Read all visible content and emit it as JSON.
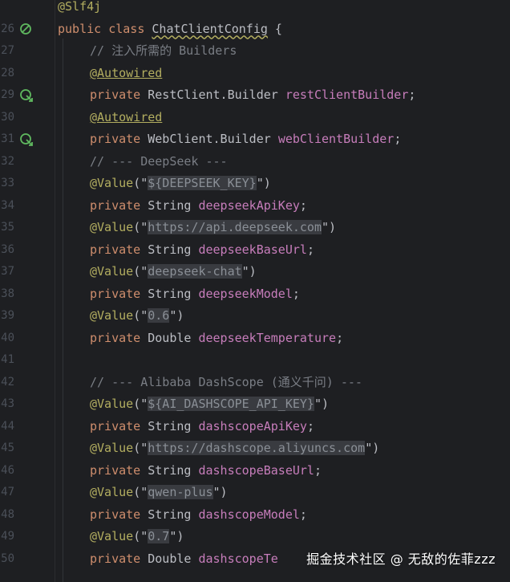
{
  "editor": {
    "lines": [
      {
        "n": "",
        "icon": null,
        "indent": 0,
        "tokens": [
          {
            "t": "@Slf4j",
            "c": "ann"
          }
        ]
      },
      {
        "n": "26",
        "icon": "spring-bean-icon",
        "indent": 0,
        "tokens": [
          {
            "t": "public ",
            "c": "kw"
          },
          {
            "t": "class ",
            "c": "kw"
          },
          {
            "t": "ChatClientConfig",
            "c": "cls-u"
          },
          {
            "t": " {",
            "c": "pl"
          }
        ]
      },
      {
        "n": "27",
        "icon": null,
        "indent": 1,
        "tokens": [
          {
            "t": "// 注入所需的 Builders",
            "c": "cmt"
          }
        ]
      },
      {
        "n": "28",
        "icon": null,
        "indent": 1,
        "tokens": [
          {
            "t": "@Autowired",
            "c": "ann-u"
          }
        ]
      },
      {
        "n": "29",
        "icon": "navigate-injection-icon",
        "indent": 1,
        "tokens": [
          {
            "t": "private ",
            "c": "kw"
          },
          {
            "t": "RestClient.Builder ",
            "c": "cls"
          },
          {
            "t": "restClientBuilder",
            "c": "fld"
          },
          {
            "t": ";",
            "c": "pl"
          }
        ]
      },
      {
        "n": "30",
        "icon": null,
        "indent": 1,
        "tokens": [
          {
            "t": "@Autowired",
            "c": "ann-u"
          }
        ]
      },
      {
        "n": "31",
        "icon": "navigate-injection-icon",
        "indent": 1,
        "tokens": [
          {
            "t": "private ",
            "c": "kw"
          },
          {
            "t": "WebClient.Builder ",
            "c": "cls"
          },
          {
            "t": "webClientBuilder",
            "c": "fld"
          },
          {
            "t": ";",
            "c": "pl"
          }
        ]
      },
      {
        "n": "32",
        "icon": null,
        "indent": 1,
        "tokens": [
          {
            "t": "// --- DeepSeek ---",
            "c": "cmt"
          }
        ]
      },
      {
        "n": "33",
        "icon": null,
        "indent": 1,
        "tokens": [
          {
            "t": "@Value",
            "c": "ann"
          },
          {
            "t": "(\"",
            "c": "pl"
          },
          {
            "t": "${DEEPSEEK_KEY}",
            "c": "str"
          },
          {
            "t": "\")",
            "c": "pl"
          }
        ]
      },
      {
        "n": "34",
        "icon": null,
        "indent": 1,
        "tokens": [
          {
            "t": "private ",
            "c": "kw"
          },
          {
            "t": "String ",
            "c": "cls"
          },
          {
            "t": "deepseekApiKey",
            "c": "fld"
          },
          {
            "t": ";",
            "c": "pl"
          }
        ]
      },
      {
        "n": "35",
        "icon": null,
        "indent": 1,
        "tokens": [
          {
            "t": "@Value",
            "c": "ann"
          },
          {
            "t": "(\"",
            "c": "pl"
          },
          {
            "t": "https://api.deepseek.com",
            "c": "str"
          },
          {
            "t": "\")",
            "c": "pl"
          }
        ]
      },
      {
        "n": "36",
        "icon": null,
        "indent": 1,
        "tokens": [
          {
            "t": "private ",
            "c": "kw"
          },
          {
            "t": "String ",
            "c": "cls"
          },
          {
            "t": "deepseekBaseUrl",
            "c": "fld"
          },
          {
            "t": ";",
            "c": "pl"
          }
        ]
      },
      {
        "n": "37",
        "icon": null,
        "indent": 1,
        "tokens": [
          {
            "t": "@Value",
            "c": "ann"
          },
          {
            "t": "(\"",
            "c": "pl"
          },
          {
            "t": "deepseek-chat",
            "c": "str"
          },
          {
            "t": "\")",
            "c": "pl"
          }
        ]
      },
      {
        "n": "38",
        "icon": null,
        "indent": 1,
        "tokens": [
          {
            "t": "private ",
            "c": "kw"
          },
          {
            "t": "String ",
            "c": "cls"
          },
          {
            "t": "deepseekModel",
            "c": "fld"
          },
          {
            "t": ";",
            "c": "pl"
          }
        ]
      },
      {
        "n": "39",
        "icon": null,
        "indent": 1,
        "tokens": [
          {
            "t": "@Value",
            "c": "ann"
          },
          {
            "t": "(\"",
            "c": "pl"
          },
          {
            "t": "0.6",
            "c": "str"
          },
          {
            "t": "\")",
            "c": "pl"
          }
        ]
      },
      {
        "n": "40",
        "icon": null,
        "indent": 1,
        "tokens": [
          {
            "t": "private ",
            "c": "kw"
          },
          {
            "t": "Double ",
            "c": "cls"
          },
          {
            "t": "deepseekTemperature",
            "c": "fld"
          },
          {
            "t": ";",
            "c": "pl"
          }
        ]
      },
      {
        "n": "41",
        "icon": null,
        "indent": 1,
        "tokens": []
      },
      {
        "n": "42",
        "icon": null,
        "indent": 1,
        "tokens": [
          {
            "t": "// --- Alibaba DashScope (通义千问) ---",
            "c": "cmt"
          }
        ]
      },
      {
        "n": "43",
        "icon": null,
        "indent": 1,
        "tokens": [
          {
            "t": "@Value",
            "c": "ann"
          },
          {
            "t": "(\"",
            "c": "pl"
          },
          {
            "t": "${AI_DASHSCOPE_API_KEY}",
            "c": "str"
          },
          {
            "t": "\")",
            "c": "pl"
          }
        ]
      },
      {
        "n": "44",
        "icon": null,
        "indent": 1,
        "tokens": [
          {
            "t": "private ",
            "c": "kw"
          },
          {
            "t": "String ",
            "c": "cls"
          },
          {
            "t": "dashscopeApiKey",
            "c": "fld"
          },
          {
            "t": ";",
            "c": "pl"
          }
        ]
      },
      {
        "n": "45",
        "icon": null,
        "indent": 1,
        "tokens": [
          {
            "t": "@Value",
            "c": "ann"
          },
          {
            "t": "(\"",
            "c": "pl"
          },
          {
            "t": "https://dashscope.aliyuncs.com",
            "c": "str"
          },
          {
            "t": "\")",
            "c": "pl"
          }
        ]
      },
      {
        "n": "46",
        "icon": null,
        "indent": 1,
        "tokens": [
          {
            "t": "private ",
            "c": "kw"
          },
          {
            "t": "String ",
            "c": "cls"
          },
          {
            "t": "dashscopeBaseUrl",
            "c": "fld"
          },
          {
            "t": ";",
            "c": "pl"
          }
        ]
      },
      {
        "n": "47",
        "icon": null,
        "indent": 1,
        "tokens": [
          {
            "t": "@Value",
            "c": "ann"
          },
          {
            "t": "(\"",
            "c": "pl"
          },
          {
            "t": "qwen-plus",
            "c": "str"
          },
          {
            "t": "\")",
            "c": "pl"
          }
        ]
      },
      {
        "n": "48",
        "icon": null,
        "indent": 1,
        "tokens": [
          {
            "t": "private ",
            "c": "kw"
          },
          {
            "t": "String ",
            "c": "cls"
          },
          {
            "t": "dashscopeModel",
            "c": "fld"
          },
          {
            "t": ";",
            "c": "pl"
          }
        ]
      },
      {
        "n": "49",
        "icon": null,
        "indent": 1,
        "tokens": [
          {
            "t": "@Value",
            "c": "ann"
          },
          {
            "t": "(\"",
            "c": "pl"
          },
          {
            "t": "0.7",
            "c": "str"
          },
          {
            "t": "\")",
            "c": "pl"
          }
        ]
      },
      {
        "n": "50",
        "icon": null,
        "indent": 1,
        "tokens": [
          {
            "t": "private ",
            "c": "kw"
          },
          {
            "t": "Double ",
            "c": "cls"
          },
          {
            "t": "dashscopeTe",
            "c": "fld"
          }
        ]
      }
    ]
  },
  "watermark": "掘金技术社区 @ 无敌的佐菲zzz",
  "colors": {
    "background": "#1e1f22",
    "keyword": "#cf8e6d",
    "annotation": "#b3ae60",
    "field": "#c77dbb",
    "comment": "#7a7e85",
    "string_highlight": "#393b40",
    "gutter_icon": "#5fb85f"
  }
}
